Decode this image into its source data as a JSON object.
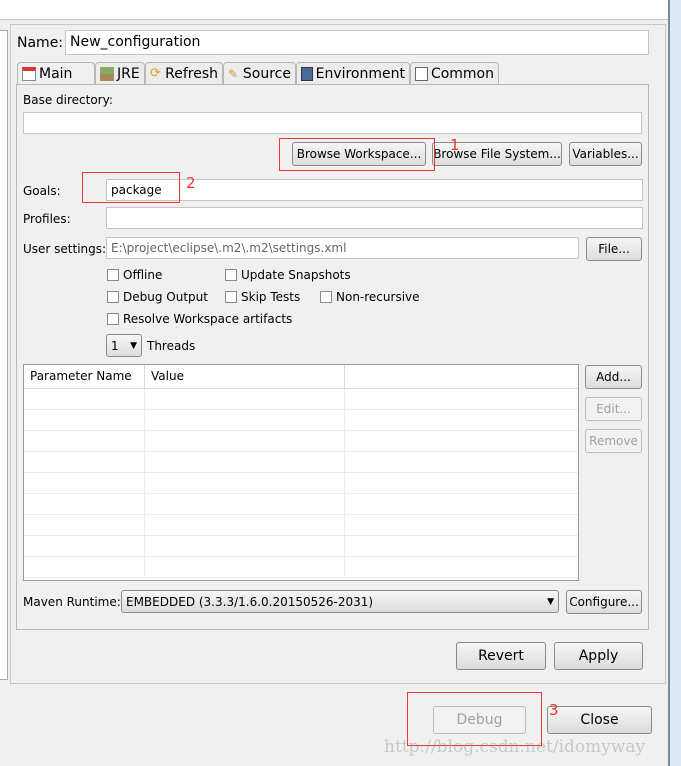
{
  "name_label": "Name:",
  "name_value": "New_configuration",
  "tabs": [
    {
      "label": "Main",
      "icon": "main-tab-icon"
    },
    {
      "label": "JRE",
      "icon": "jre-icon"
    },
    {
      "label": "Refresh",
      "icon": "refresh-icon"
    },
    {
      "label": "Source",
      "icon": "source-icon"
    },
    {
      "label": "Environment",
      "icon": "environment-icon"
    },
    {
      "label": "Common",
      "icon": "common-icon"
    }
  ],
  "main": {
    "base_directory_label": "Base directory:",
    "base_directory_value": "",
    "browse_workspace": "Browse Workspace...",
    "browse_file_system": "Browse File System...",
    "variables": "Variables...",
    "goals_label": "Goals:",
    "goals_value": "package",
    "profiles_label": "Profiles:",
    "profiles_value": "",
    "user_settings_label": "User settings:",
    "user_settings_value": "E:\\project\\eclipse\\.m2\\.m2\\settings.xml",
    "file_button": "File...",
    "checkboxes": {
      "offline": "Offline",
      "update_snapshots": "Update Snapshots",
      "debug_output": "Debug Output",
      "skip_tests": "Skip Tests",
      "non_recursive": "Non-recursive",
      "resolve_workspace": "Resolve Workspace artifacts"
    },
    "threads_value": "1",
    "threads_label": "Threads",
    "params_columns": [
      "Parameter Name",
      "Value",
      ""
    ],
    "add": "Add...",
    "edit": "Edit...",
    "remove": "Remove",
    "maven_runtime_label": "Maven Runtime:",
    "maven_runtime_value": "EMBEDDED (3.3.3/1.6.0.20150526-2031)",
    "configure": "Configure..."
  },
  "revert": "Revert",
  "apply": "Apply",
  "debug": "Debug",
  "close": "Close",
  "annotations": [
    "1",
    "2",
    "3"
  ],
  "watermark": "http://blog.csdn.net/idomyway",
  "colors": {
    "annotation": "#e33333"
  }
}
